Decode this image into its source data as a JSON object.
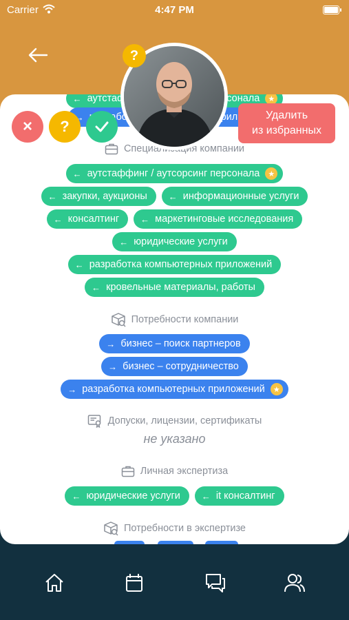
{
  "status_bar": {
    "carrier": "Carrier",
    "time": "4:47 PM"
  },
  "actions": {
    "remove_favorite_line1": "Удалить",
    "remove_favorite_line2": "из избранных",
    "reject_glyph": "×",
    "question_glyph": "?",
    "help_glyph": "?"
  },
  "peek_chips": [
    "аутстаффинг / аутсорсинг персонала",
    "разработка компьютерных приложений"
  ],
  "sections": {
    "company_specialization": {
      "title": "Специализация компании",
      "chips": [
        {
          "label": "аутстаффинг / аутсорсинг персонала",
          "starred": true
        },
        {
          "label": "закупки, аукционы"
        },
        {
          "label": "информационные услуги"
        },
        {
          "label": "консалтинг"
        },
        {
          "label": "маркетинговые исследования"
        },
        {
          "label": "юридические услуги"
        },
        {
          "label": "разработка компьютерных приложений"
        },
        {
          "label": "кровельные материалы, работы"
        }
      ]
    },
    "company_needs": {
      "title": "Потребности компании",
      "chips": [
        {
          "label": "бизнес – поиск партнеров"
        },
        {
          "label": "бизнес – сотрудничество"
        },
        {
          "label": "разработка компьютерных приложений",
          "starred": true
        }
      ]
    },
    "licenses": {
      "title": "Допуски, лицензии, сертификаты",
      "value": "не указано"
    },
    "personal_expertise": {
      "title": "Личная экспертиза",
      "chips": [
        {
          "label": "юридические услуги"
        },
        {
          "label": "it консалтинг"
        }
      ]
    },
    "expertise_needs": {
      "title": "Потребности в экспертизе"
    }
  },
  "glyphs": {
    "arrow_left": "←",
    "arrow_right": "→",
    "star": "★"
  },
  "icons": [
    "back-arrow-icon",
    "briefcase-icon",
    "box-icon",
    "certificate-icon",
    "home-icon",
    "calendar-icon",
    "chat-icon",
    "users-icon",
    "check-icon"
  ],
  "colors": {
    "header": "#d8963f",
    "tabbar": "#12303f",
    "green_chip": "#2ec98f",
    "blue_chip": "#3b82ee",
    "remove": "#f26d6d",
    "question": "#f5b800",
    "confirm": "#2ec98f"
  }
}
